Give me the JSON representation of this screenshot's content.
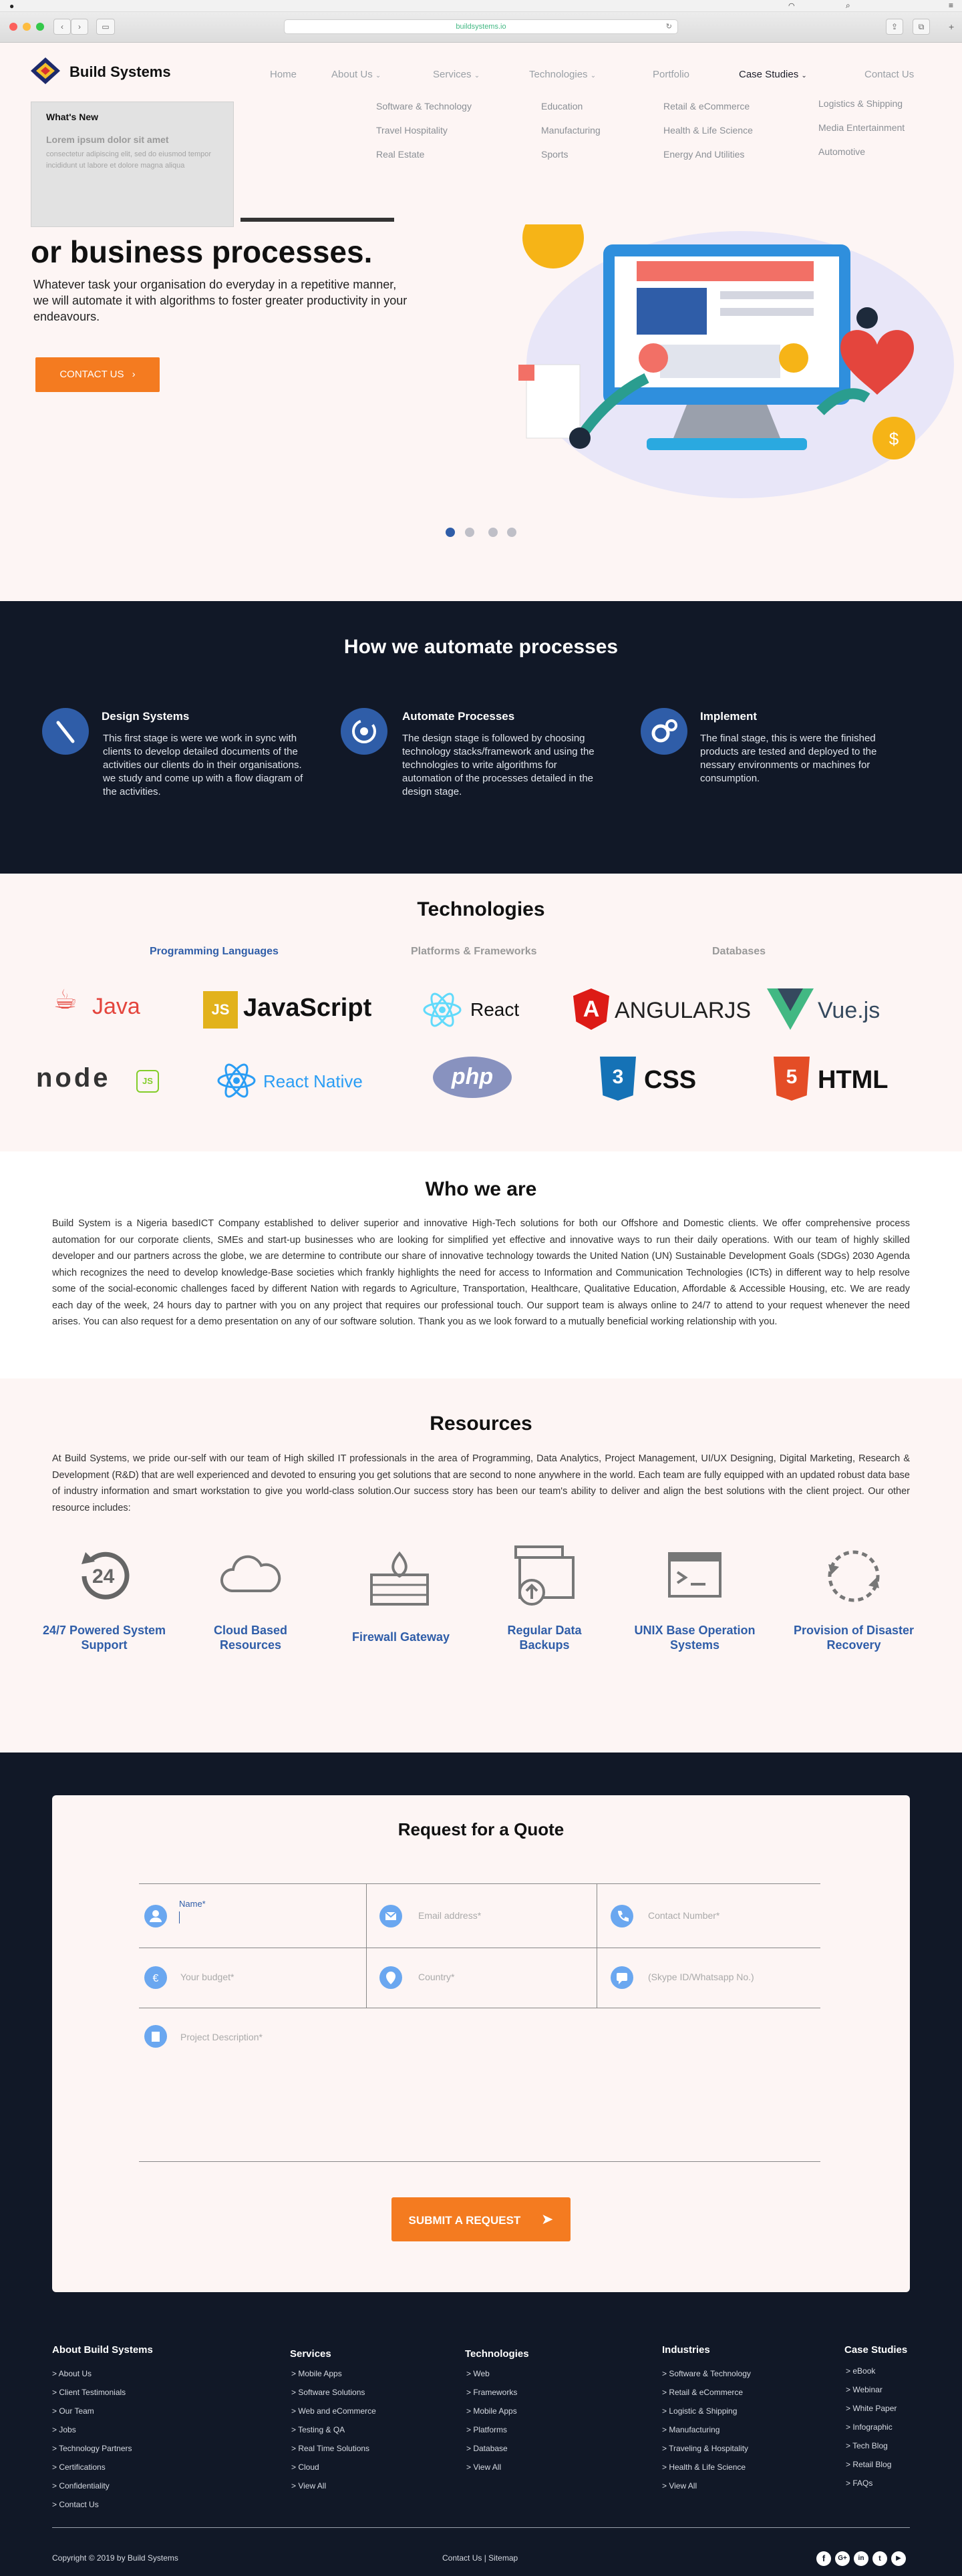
{
  "browser": {
    "url": "buildsystems.io"
  },
  "brand": {
    "name": "Build Systems"
  },
  "nav": {
    "items": [
      "Home",
      "About Us",
      "Services",
      "Technologies",
      "Portfolio",
      "Case Studies",
      "Contact Us"
    ],
    "dropdown": {
      "col1": [
        "Software & Technology",
        "Travel Hospitality",
        "Real Estate"
      ],
      "col2": [
        "Education",
        "Manufacturing",
        "Sports"
      ],
      "col3": [
        "Retail & eCommerce",
        "Health & Life Science",
        "Energy And Utilities"
      ],
      "col4": [
        "Logistics & Shipping",
        "Media Entertainment",
        "Automotive"
      ]
    }
  },
  "whats_new": {
    "title": "What's New",
    "headline": "Lorem ipsum dolor sit amet",
    "body": "consectetur adipiscing elit, sed do eiusmod tempor incididunt ut labore et dolore magna aliqua"
  },
  "hero": {
    "heading_partial": "or business processes.",
    "description": "Whatever task your organisation do everyday in a repetitive manner, we will automate it with algorithms to foster greater productivity in your endeavours.",
    "cta": "CONTACT US"
  },
  "how": {
    "title": "How we automate processes",
    "steps": [
      {
        "title": "Design Systems",
        "text": "This first stage is were we work in sync with clients to develop detailed documents of the activities our clients do in their organisations. we study and come up with a flow diagram of the activities."
      },
      {
        "title": "Automate Processes",
        "text": "The design stage is followed by choosing technology stacks/framework and using the technologies to write algorithms for automation of the processes detailed in the design stage."
      },
      {
        "title": "Implement",
        "text": "The final stage, this is were the finished products are tested and deployed to the nessary environments or machines for consumption."
      }
    ]
  },
  "technologies": {
    "title": "Technologies",
    "tabs": [
      "Programming Languages",
      "Platforms & Frameworks",
      "Databases"
    ],
    "logos": [
      "Java",
      "JavaScript",
      "React",
      "ANGULARJS",
      "Vue.js",
      "node",
      "React Native",
      "php",
      "CSS",
      "HTML"
    ]
  },
  "who": {
    "title": "Who we are",
    "text": "Build System is a Nigeria basedICT Company established to deliver superior and innovative High-Tech solutions for both our Offshore and Domestic clients. We offer comprehensive process automation for our corporate clients, SMEs and start-up businesses who are looking for simplified yet effective and innovative ways to run their daily operations. With our team of highly skilled developer and our partners across the globe, we are determine to contribute our share of innovative technology towards the United Nation (UN) Sustainable Development Goals (SDGs) 2030 Agenda which recognizes the need to develop knowledge-Base societies which frankly highlights the need for access to Information and Communication Technologies (ICTs) in different way to help resolve some of the social-economic challenges faced by different Nation with regards to Agriculture, Transportation, Healthcare, Qualitative Education, Affordable & Accessible Housing, etc. We are ready each day of the week, 24 hours day to partner with you on any project that requires our professional touch. Our support team is always online to 24/7 to attend to your request whenever the need arises. You can also request for a demo presentation on any of our software solution. Thank you as we look forward to a mutually beneficial working relationship with you."
  },
  "resources": {
    "title": "Resources",
    "text": "At Build Systems, we pride our-self with our team of High skilled IT professionals in the area of Programming, Data Analytics, Project Management, UI/UX Designing, Digital Marketing, Research & Development (R&D) that are well experienced and devoted to ensuring you get solutions that are second to none anywhere in the world. Each team are fully equipped with an updated robust data base of industry information and smart workstation to give you world-class solution.Our success story has been our team's ability to deliver and align the best solutions with the client project. Our other resource includes:",
    "items": [
      "24/7 Powered System Support",
      "Cloud Based Resources",
      "Firewall Gateway",
      "Regular Data Backups",
      "UNIX Base Operation Systems",
      "Provision of Disaster Recovery"
    ],
    "clock_number": "24"
  },
  "quote": {
    "title": "Request for a Quote",
    "fields": [
      "Name*",
      "Email address*",
      "Contact Number*",
      "Your budget*",
      "Country*",
      "(Skype ID/Whatsapp No.)",
      "Project Description*"
    ],
    "submit": "SUBMIT A REQUEST"
  },
  "footer": {
    "columns": [
      {
        "title": "About Build Systems",
        "links": [
          "> About Us",
          "> Client Testimonials",
          "> Our Team",
          "> Jobs",
          "> Technology Partners",
          "> Certifications",
          "> Confidentiality",
          "> Contact Us"
        ]
      },
      {
        "title": "Services",
        "links": [
          "> Mobile Apps",
          "> Software Solutions",
          "> Web and eCommerce",
          "> Testing & QA",
          "> Real Time Solutions",
          "> Cloud",
          "> View All"
        ]
      },
      {
        "title": "Technologies",
        "links": [
          "> Web",
          "> Frameworks",
          "> Mobile Apps",
          "> Platforms",
          "> Database",
          "> View All"
        ]
      },
      {
        "title": "Industries",
        "links": [
          "> Software & Technology",
          "> Retail & eCommerce",
          "> Logistic & Shipping",
          "> Manufacturing",
          "> Traveling & Hospitality",
          "> Health & Life Science",
          "> View All"
        ]
      },
      {
        "title": "Case Studies",
        "links": [
          "> eBook",
          "> Webinar",
          "> White Paper",
          "> Infographic",
          "> Tech Blog",
          "> Retail Blog",
          "> FAQs"
        ]
      }
    ],
    "copyright": "Copyright © 2019 by Build Systems",
    "bottom_links": "Contact Us | Sitemap"
  },
  "colors": {
    "accent": "#f47b20",
    "brand_blue": "#2f5da8",
    "dark": "#111827",
    "hero_bg": "#fdf5f4"
  }
}
